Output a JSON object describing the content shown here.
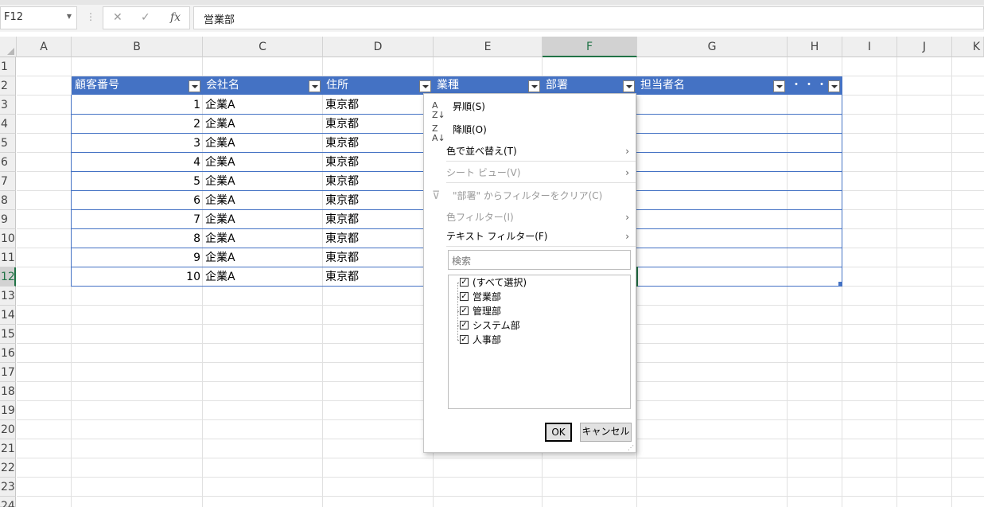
{
  "formula_bar": {
    "name_box": "F12",
    "formula": "営業部",
    "cancel_glyph": "✕",
    "enter_glyph": "✓",
    "fx_glyph": "fx"
  },
  "columns": [
    "A",
    "B",
    "C",
    "D",
    "E",
    "F",
    "G",
    "H",
    "I",
    "J",
    "K"
  ],
  "rows": [
    "1",
    "2",
    "3",
    "4",
    "5",
    "6",
    "7",
    "8",
    "9",
    "10",
    "11",
    "12",
    "13",
    "14",
    "15",
    "16",
    "17",
    "18",
    "19",
    "20",
    "21",
    "22",
    "23",
    "24"
  ],
  "table": {
    "headers": [
      "顧客番号",
      "会社名",
      "住所",
      "業種",
      "部署",
      "担当者名",
      "・・・"
    ],
    "rows": [
      {
        "id": "1",
        "company": "企業A",
        "address": "東京都"
      },
      {
        "id": "2",
        "company": "企業A",
        "address": "東京都"
      },
      {
        "id": "3",
        "company": "企業A",
        "address": "東京都"
      },
      {
        "id": "4",
        "company": "企業A",
        "address": "東京都"
      },
      {
        "id": "5",
        "company": "企業A",
        "address": "東京都"
      },
      {
        "id": "6",
        "company": "企業A",
        "address": "東京都"
      },
      {
        "id": "7",
        "company": "企業A",
        "address": "東京都"
      },
      {
        "id": "8",
        "company": "企業A",
        "address": "東京都"
      },
      {
        "id": "9",
        "company": "企業A",
        "address": "東京都"
      },
      {
        "id": "10",
        "company": "企業A",
        "address": "東京都"
      }
    ]
  },
  "filter_menu": {
    "sort_asc": "昇順(S)",
    "sort_desc": "降順(O)",
    "sort_by_color": "色で並べ替え(T)",
    "sheet_view": "シート ビュー(V)",
    "clear_filter": "\"部署\" からフィルターをクリア(C)",
    "color_filter": "色フィルター(I)",
    "text_filter": "テキスト フィルター(F)",
    "search_placeholder": "検索",
    "items": [
      "(すべて選択)",
      "営業部",
      "管理部",
      "システム部",
      "人事部"
    ],
    "ok": "OK",
    "cancel": "キャンセル"
  },
  "colors": {
    "table_header": "#4472c4",
    "selected_header": "#217346"
  }
}
